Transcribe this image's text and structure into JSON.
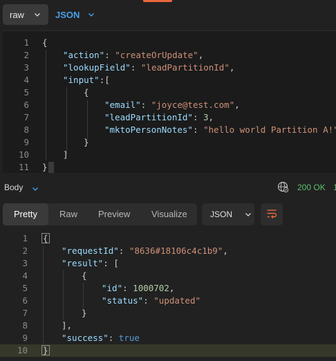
{
  "request": {
    "mode_label": "raw",
    "format_label": "JSON",
    "code_lines": [
      {
        "num": "1",
        "tokens": [
          {
            "t": "{",
            "c": "punc"
          }
        ]
      },
      {
        "num": "2",
        "tokens": [
          {
            "t": "\"action\"",
            "c": "key"
          },
          {
            "t": ": ",
            "c": "punc"
          },
          {
            "t": "\"createOrUpdate\"",
            "c": "str"
          },
          {
            "t": ",",
            "c": "punc"
          }
        ]
      },
      {
        "num": "3",
        "tokens": [
          {
            "t": "\"lookupField\"",
            "c": "key"
          },
          {
            "t": ": ",
            "c": "punc"
          },
          {
            "t": "\"leadPartitionId\"",
            "c": "str"
          },
          {
            "t": ",",
            "c": "punc"
          }
        ]
      },
      {
        "num": "4",
        "tokens": [
          {
            "t": "\"input\"",
            "c": "key"
          },
          {
            "t": ":[",
            "c": "punc"
          }
        ]
      },
      {
        "num": "5",
        "tokens": [
          {
            "t": "{",
            "c": "punc"
          }
        ]
      },
      {
        "num": "6",
        "tokens": [
          {
            "t": "\"email\"",
            "c": "key"
          },
          {
            "t": ": ",
            "c": "punc"
          },
          {
            "t": "\"joyce@test.com\"",
            "c": "str"
          },
          {
            "t": ",",
            "c": "punc"
          }
        ]
      },
      {
        "num": "7",
        "tokens": [
          {
            "t": "\"leadPartitionId\"",
            "c": "key"
          },
          {
            "t": ": ",
            "c": "punc"
          },
          {
            "t": "3",
            "c": "num"
          },
          {
            "t": ",",
            "c": "punc"
          }
        ]
      },
      {
        "num": "8",
        "tokens": [
          {
            "t": "\"mktoPersonNotes\"",
            "c": "key"
          },
          {
            "t": ": ",
            "c": "punc"
          },
          {
            "t": "\"hello world Partition A!\"",
            "c": "str"
          }
        ]
      },
      {
        "num": "9",
        "tokens": [
          {
            "t": "}",
            "c": "punc"
          }
        ]
      },
      {
        "num": "10",
        "tokens": [
          {
            "t": "]",
            "c": "punc"
          }
        ]
      },
      {
        "num": "11",
        "tokens": [
          {
            "t": "}",
            "c": "punc"
          }
        ]
      }
    ]
  },
  "response": {
    "body_label": "Body",
    "status_text": "200 OK",
    "status_trail": "1",
    "tabs": [
      "Pretty",
      "Raw",
      "Preview",
      "Visualize"
    ],
    "active_tab": "Pretty",
    "format_label": "JSON",
    "code_lines": [
      {
        "num": "1",
        "tokens": [
          {
            "t": "{",
            "c": "punc"
          }
        ]
      },
      {
        "num": "2",
        "tokens": [
          {
            "t": "\"requestId\"",
            "c": "key"
          },
          {
            "t": ": ",
            "c": "punc"
          },
          {
            "t": "\"8636#18106c4c1b9\"",
            "c": "str"
          },
          {
            "t": ",",
            "c": "punc"
          }
        ]
      },
      {
        "num": "3",
        "tokens": [
          {
            "t": "\"result\"",
            "c": "key"
          },
          {
            "t": ": [",
            "c": "punc"
          }
        ]
      },
      {
        "num": "4",
        "tokens": [
          {
            "t": "{",
            "c": "punc"
          }
        ]
      },
      {
        "num": "5",
        "tokens": [
          {
            "t": "\"id\"",
            "c": "key"
          },
          {
            "t": ": ",
            "c": "punc"
          },
          {
            "t": "1000702",
            "c": "num"
          },
          {
            "t": ",",
            "c": "punc"
          }
        ]
      },
      {
        "num": "6",
        "tokens": [
          {
            "t": "\"status\"",
            "c": "key"
          },
          {
            "t": ": ",
            "c": "punc"
          },
          {
            "t": "\"updated\"",
            "c": "str"
          }
        ]
      },
      {
        "num": "7",
        "tokens": [
          {
            "t": "}",
            "c": "punc"
          }
        ]
      },
      {
        "num": "8",
        "tokens": [
          {
            "t": "],",
            "c": "punc"
          }
        ]
      },
      {
        "num": "9",
        "tokens": [
          {
            "t": "\"success\"",
            "c": "key"
          },
          {
            "t": ": ",
            "c": "punc"
          },
          {
            "t": "true",
            "c": "kw"
          }
        ]
      },
      {
        "num": "10",
        "tokens": [
          {
            "t": "}",
            "c": "punc"
          }
        ]
      }
    ]
  },
  "colors": {
    "accent_orange": "#e8673c",
    "link_blue": "#4a9fe8",
    "status_green": "#5cbf6b"
  },
  "icons": [
    "chevron-down-icon",
    "globe-icon",
    "wrap-lines-icon"
  ]
}
